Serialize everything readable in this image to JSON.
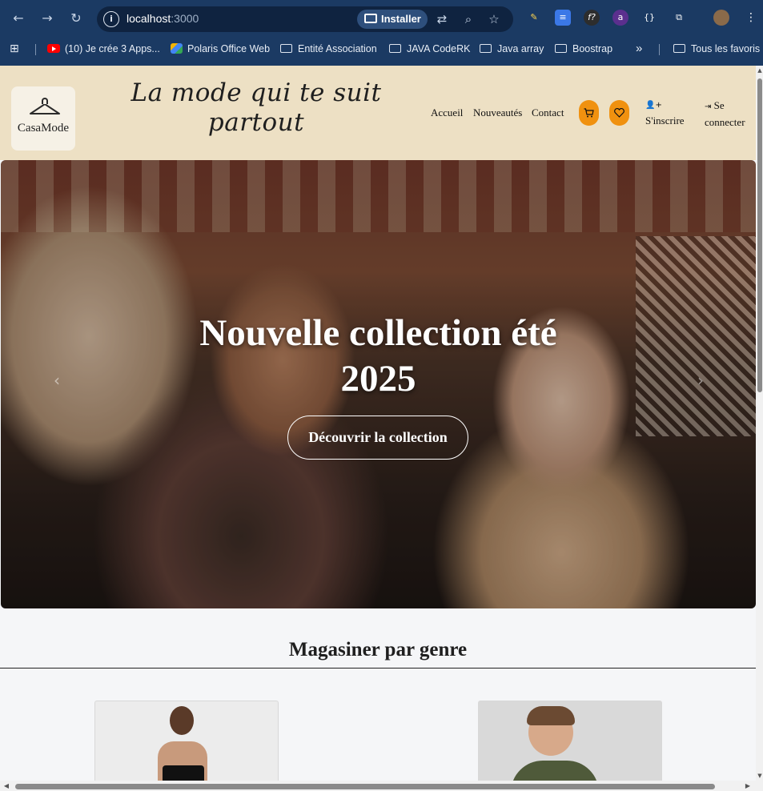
{
  "browser": {
    "url_host": "localhost",
    "url_port": ":3000",
    "install_label": "Installer",
    "bookmarks": [
      {
        "label": "(10) Je crée 3 Apps...",
        "icon": "youtube-icon"
      },
      {
        "label": "Polaris Office Web",
        "icon": "polaris-icon"
      },
      {
        "label": "Entité Association",
        "icon": "folder-icon"
      },
      {
        "label": "JAVA CodeRK",
        "icon": "folder-icon"
      },
      {
        "label": "Java array",
        "icon": "folder-icon"
      },
      {
        "label": "Boostrap",
        "icon": "folder-icon"
      }
    ],
    "all_bookmarks_label": "Tous les favoris",
    "overflow_label": "»"
  },
  "header": {
    "logo_text": "CasaMode",
    "tagline": "La mode qui te suit partout",
    "nav": [
      "Accueil",
      "Nouveautés",
      "Contact"
    ],
    "signup_label": "S'inscrire",
    "login_label": "Se connecter"
  },
  "hero": {
    "title": "Nouvelle collection été 2025",
    "cta_label": "Découvrir la collection"
  },
  "section": {
    "title": "Magasiner par genre"
  },
  "colors": {
    "chrome": "#1b3a63",
    "header_bg": "#ede0c4",
    "accent": "#f0910f"
  }
}
